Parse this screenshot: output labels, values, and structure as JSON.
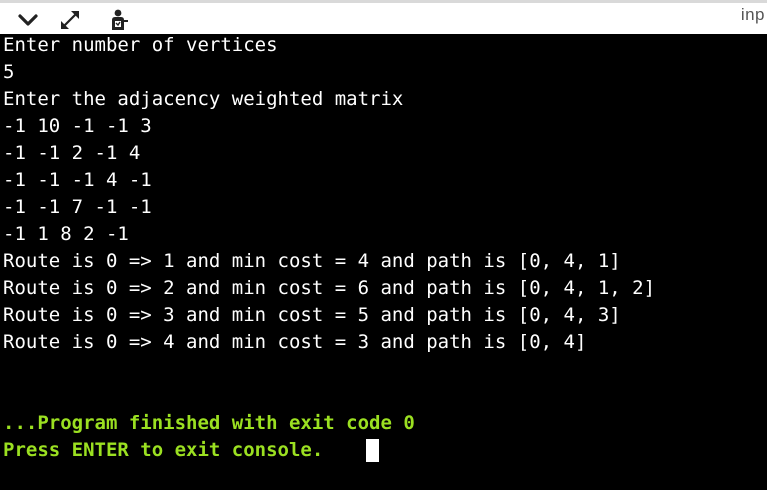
{
  "toolbar": {
    "tab_label": "inp",
    "icons": {
      "collapse": "chevron-down-icon",
      "expand": "expand-arrows-icon",
      "run": "run-user-icon"
    }
  },
  "console": {
    "lines": [
      "Enter number of vertices",
      "5",
      "Enter the adjacency weighted matrix",
      "-1 10 -1 -1 3",
      "-1 -1 2 -1 4",
      "-1 -1 -1 4 -1",
      "-1 -1 7 -1 -1",
      "-1 1 8 2 -1",
      "Route is 0 => 1 and min cost = 4 and path is [0, 4, 1]",
      "Route is 0 => 2 and min cost = 6 and path is [0, 4, 1, 2]",
      "Route is 0 => 3 and min cost = 5 and path is [0, 4, 3]",
      "Route is 0 => 4 and min cost = 3 and path is [0, 4]"
    ],
    "finish_message": "...Program finished with exit code 0",
    "exit_prompt": "Press ENTER to exit console."
  },
  "colors": {
    "background": "#000000",
    "text": "#ffffff",
    "finish_text": "#9be021"
  }
}
